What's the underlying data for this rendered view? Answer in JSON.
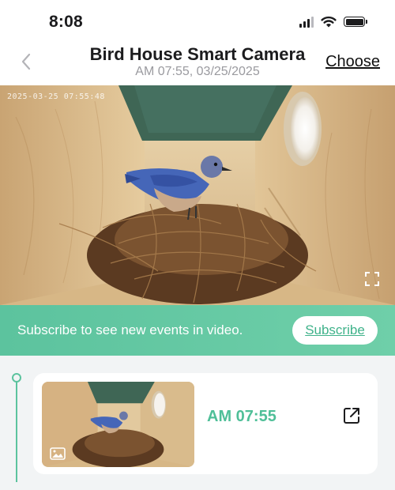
{
  "status_bar": {
    "time": "8:08",
    "icons": [
      "cellular-signal-icon",
      "wifi-icon",
      "battery-icon"
    ]
  },
  "header": {
    "back_icon": "chevron-left-icon",
    "title": "Bird House Smart Camera",
    "subtitle": "AM 07:55, 03/25/2025",
    "choose_label": "Choose"
  },
  "video": {
    "timestamp_overlay": "2025-03-25 07:55:48",
    "fullscreen_icon": "fullscreen-icon"
  },
  "banner": {
    "text": "Subscribe to see new events in video.",
    "subscribe_label": "Subscribe"
  },
  "events": [
    {
      "time": "AM 07:55",
      "media_icon": "image-icon",
      "action_icon": "share-icon"
    }
  ],
  "colors": {
    "accent": "#5cc39e",
    "accent_text": "#4fbf98",
    "title_text": "#1c1c1e",
    "subtitle_text": "#9a9a9f",
    "events_background": "#f2f4f5"
  }
}
